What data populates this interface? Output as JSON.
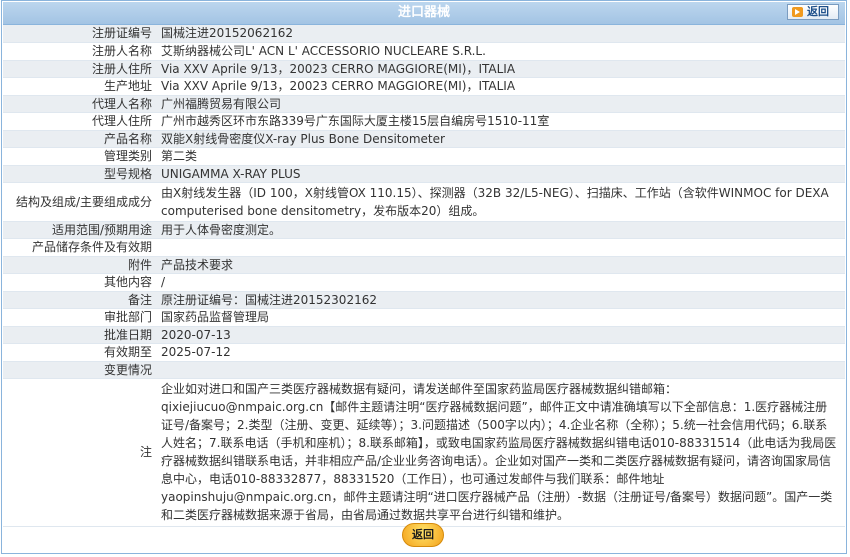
{
  "header": {
    "title": "进口器械",
    "back_label": "返回"
  },
  "rows": [
    {
      "label": "注册证编号",
      "value": "国械注进20152062162"
    },
    {
      "label": "注册人名称",
      "value": "艾斯纳器械公司L' ACN L' ACCESSORIO NUCLEARE S.R.L."
    },
    {
      "label": "注册人住所",
      "value": "Via XXV Aprile 9/13，20023 CERRO MAGGIORE(MI)，ITALIA"
    },
    {
      "label": "生产地址",
      "value": "Via XXV Aprile 9/13，20023 CERRO MAGGIORE(MI)，ITALIA"
    },
    {
      "label": "代理人名称",
      "value": "广州福腾贸易有限公司"
    },
    {
      "label": "代理人住所",
      "value": "广州市越秀区环市东路339号广东国际大厦主楼15层自编房号1510-11室"
    },
    {
      "label": "产品名称",
      "value": "双能X射线骨密度仪X-ray Plus Bone Densitometer"
    },
    {
      "label": "管理类别",
      "value": "第二类"
    },
    {
      "label": "型号规格",
      "value": "UNIGAMMA X-RAY PLUS"
    },
    {
      "label": "结构及组成/主要组成成分",
      "value": "由X射线发生器（ID 100，X射线管OX 110.15）、探测器（32B 32/L5-NEG）、扫描床、工作站（含软件WINMOC for DEXA computerised bone densitometry，发布版本20）组成。"
    },
    {
      "label": "适用范围/预期用途",
      "value": "用于人体骨密度测定。"
    },
    {
      "label": "产品储存条件及有效期",
      "value": ""
    },
    {
      "label": "附件",
      "value": "产品技术要求"
    },
    {
      "label": "其他内容",
      "value": "/"
    },
    {
      "label": "备注",
      "value": "原注册证编号：国械注进20152302162"
    },
    {
      "label": "审批部门",
      "value": "国家药品监督管理局"
    },
    {
      "label": "批准日期",
      "value": "2020-07-13"
    },
    {
      "label": "有效期至",
      "value": "2025-07-12"
    },
    {
      "label": "变更情况",
      "value": ""
    },
    {
      "label": "注",
      "value": "企业如对进口和国产三类医疗器械数据有疑问，请发送邮件至国家药监局医疗器械数据纠错邮箱：qixiejiucuo@nmpaic.org.cn【邮件主题请注明“医疗器械数据问题”，邮件正文中请准确填写以下全部信息：1.医疗器械注册证号/备案号；2.类型（注册、变更、延续等）；3.问题描述（500字以内）；4.企业名称（全称）；5.统一社会信用代码；6.联系人姓名；7.联系电话（手机和座机）；8.联系邮箱】，或致电国家药监局医疗器械数据纠错电话010-88331514（此电话为我局医疗器械数据纠错联系电话，并非相应产品/企业业务咨询电话）。企业如对国产一类和二类医疗器械数据有疑问，请咨询国家局信息中心，电话010-88332877，88331520（工作日），也可通过发邮件与我们联系：邮件地址yaopinshuju@nmpaic.org.cn，邮件主题请注明“进口医疗器械产品（注册）-数据（注册证号/备案号）数据问题”。国产一类和二类医疗器械数据来源于省局，由省局通过数据共享平台进行纠错和维护。"
    }
  ],
  "footer": {
    "back_label": "返回"
  }
}
